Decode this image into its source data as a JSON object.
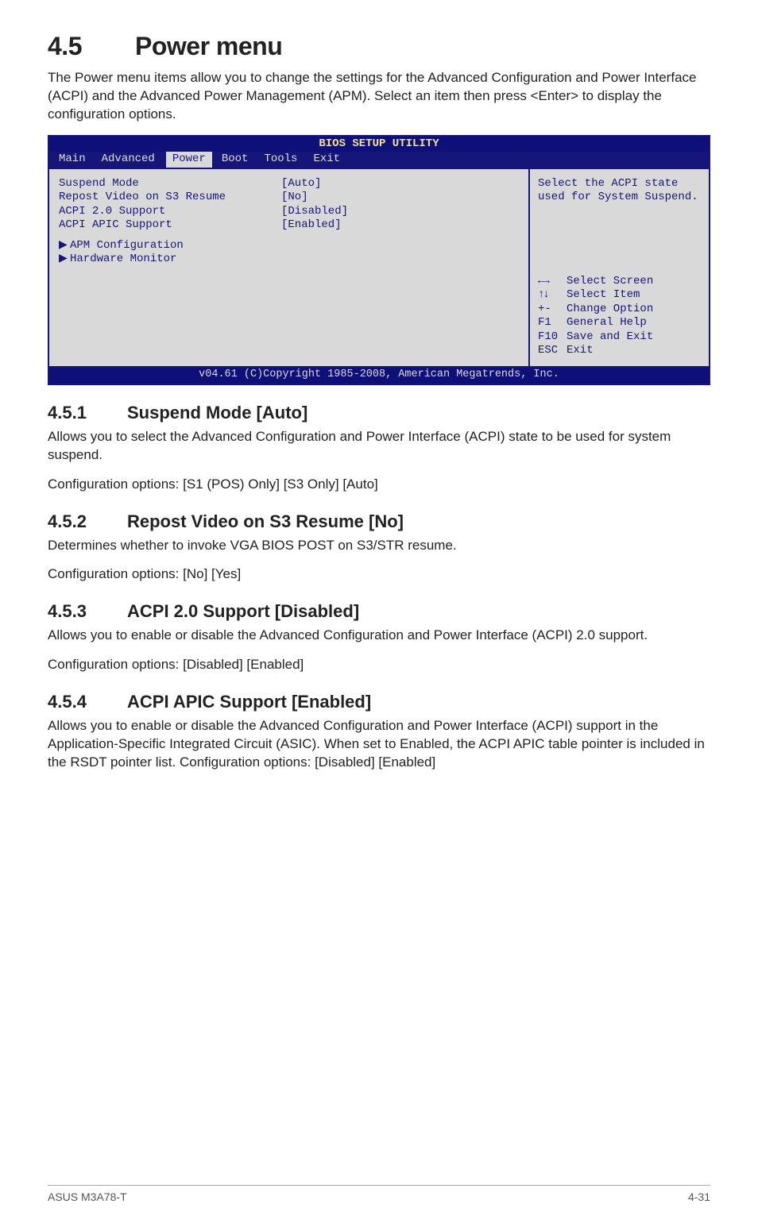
{
  "section": {
    "number": "4.5",
    "title": "Power menu",
    "intro": "The Power menu items allow you to change the settings for the Advanced Configuration and Power Interface (ACPI) and the Advanced Power Management (APM). Select an item then press <Enter> to display the configuration options."
  },
  "bios": {
    "header": "BIOS SETUP UTILITY",
    "tabs": [
      "Main",
      "Advanced",
      "Power",
      "Boot",
      "Tools",
      "Exit"
    ],
    "selected_tab_index": 2,
    "rows": [
      {
        "label": "Suspend Mode",
        "value": "[Auto]"
      },
      {
        "label": "Repost Video on S3 Resume",
        "value": "[No]"
      },
      {
        "label": "ACPI 2.0 Support",
        "value": "[Disabled]"
      },
      {
        "label": "ACPI APIC Support",
        "value": "[Enabled]"
      }
    ],
    "subitems": [
      "APM Configuration",
      "Hardware Monitor"
    ],
    "help_text": "Select the ACPI state used for System Suspend.",
    "legend": [
      {
        "key": "arrows-horiz",
        "label": "Select Screen"
      },
      {
        "key": "arrows-vert",
        "label": "Select Item"
      },
      {
        "key": "+-",
        "label": "Change Option"
      },
      {
        "key": "F1",
        "label": "General Help"
      },
      {
        "key": "F10",
        "label": "Save and Exit"
      },
      {
        "key": "ESC",
        "label": "Exit"
      }
    ],
    "footer": "v04.61 (C)Copyright 1985-2008, American Megatrends, Inc."
  },
  "subs": [
    {
      "num": "4.5.1",
      "title": "Suspend Mode [Auto]",
      "body1": "Allows you to select the Advanced Configuration and Power Interface (ACPI) state to be used for system suspend.",
      "body2": "Configuration options: [S1 (POS) Only] [S3 Only] [Auto]"
    },
    {
      "num": "4.5.2",
      "title": "Repost Video on S3 Resume [No]",
      "body1": "Determines whether to invoke VGA BIOS POST on S3/STR resume.",
      "body2": "Configuration options: [No] [Yes]"
    },
    {
      "num": "4.5.3",
      "title": "ACPI 2.0 Support [Disabled]",
      "body1": "Allows you to enable or disable the Advanced Configuration and Power Interface (ACPI) 2.0 support.",
      "body2": "Configuration options: [Disabled] [Enabled]"
    },
    {
      "num": "4.5.4",
      "title": "ACPI APIC Support [Enabled]",
      "body1": "Allows you to enable or disable the Advanced Configuration and Power Interface (ACPI) support in the Application-Specific Integrated Circuit (ASIC). When set to Enabled, the ACPI APIC table pointer is included in the RSDT pointer list. Configuration options: [Disabled] [Enabled]",
      "body2": ""
    }
  ],
  "footer": {
    "left": "ASUS M3A78-T",
    "right": "4-31"
  }
}
